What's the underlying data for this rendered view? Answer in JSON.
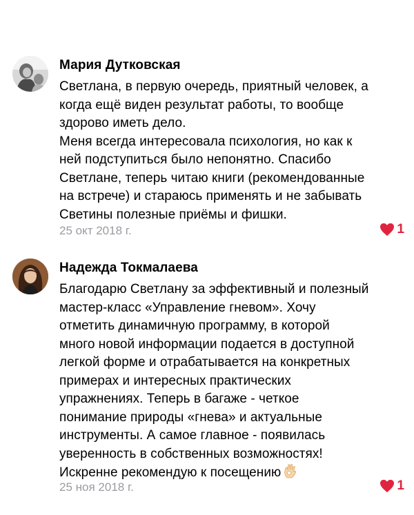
{
  "reviews": [
    {
      "author": "Мария Дутковская",
      "avatar_icon": "person-photo-avatar",
      "lines": [
        "Светлана, в первую очередь, приятный человек, а",
        "когда ещё виден результат работы, то вообще",
        "здорово иметь дело.",
        "Меня всегда интересовала психология, но как к",
        "ней подступиться было непонятно. Спасибо",
        "Светлане, теперь читаю книги (рекомендованные",
        "на встрече) и стараюсь применять и не забывать",
        "Светины полезные приёмы и фишки."
      ],
      "date": "25 окт 2018 г.",
      "likes": "1"
    },
    {
      "author": "Надежда Токмалаева",
      "avatar_icon": "person-photo-avatar",
      "lines": [
        "Благодарю Светлану за эффективный и полезный",
        "мастер-класс «Управление гневом». Хочу",
        "отметить динамичную программу, в которой",
        "много новой информации подается в доступной",
        "легкой форме и отрабатывается на конкретных",
        "примерах и интересных практических",
        "упражнениях. Теперь в багаже - четкое",
        "понимание природы «гнева» и актуальные",
        "инструменты. А самое главное - появилась",
        "уверенность в собственных возможностях!",
        "Искренне рекомендую к посещению"
      ],
      "trailing_icon": "ok-hand-emoji-icon",
      "date": "25 ноя 2018 г.",
      "likes": "1"
    }
  ],
  "colors": {
    "like": "#e0243f",
    "date": "#9a9ba0",
    "text": "#000000"
  }
}
